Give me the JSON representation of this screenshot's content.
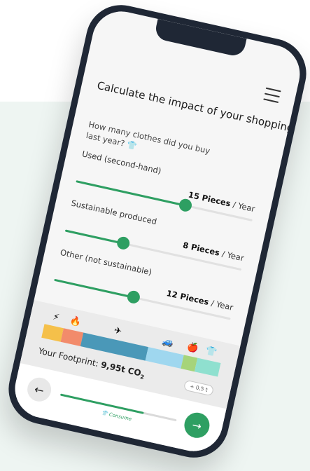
{
  "page": {
    "title": "Calculate the impact of your shopping",
    "question": "How many clothes did you buy last year?",
    "question_icon": "shirt-icon"
  },
  "sliders": [
    {
      "label": "Used (second-hand)",
      "value": "15 Pieces",
      "unit": "/ Year",
      "level": 0.62
    },
    {
      "label": "Sustainable produced",
      "value": "8 Pieces",
      "unit": "/ Year",
      "level": 0.33
    },
    {
      "label": "Other (not sustainable)",
      "value": "12 Pieces",
      "unit": "/ Year",
      "level": 0.45
    }
  ],
  "footprint": {
    "label": "Your Footprint:",
    "value": "9,95t CO",
    "subscript": "2",
    "delta": "+ 0,5 t",
    "categories": [
      {
        "icon": "lightning-icon",
        "glyph": "⚡",
        "color": "#f5c04a",
        "share": 0.11
      },
      {
        "icon": "fire-icon",
        "glyph": "🔥",
        "color": "#f28b6b",
        "share": 0.11
      },
      {
        "icon": "plane-icon",
        "glyph": "✈",
        "color": "#4a98b8",
        "share": 0.37
      },
      {
        "icon": "car-icon",
        "glyph": "🚙",
        "color": "#9fd7ef",
        "share": 0.2
      },
      {
        "icon": "apple-icon",
        "glyph": "🍎",
        "color": "#a6d47a",
        "share": 0.08
      },
      {
        "icon": "shirt-icon",
        "glyph": "👕",
        "color": "#8fe0cf",
        "share": 0.13
      }
    ]
  },
  "nav": {
    "back_icon": "arrow-left-icon",
    "next_icon": "arrow-right-icon",
    "step_label": "Consume",
    "progress": 0.72
  },
  "colors": {
    "accent": "#2e9f62",
    "background": "#eef5f2",
    "phone": "#1f2735"
  }
}
